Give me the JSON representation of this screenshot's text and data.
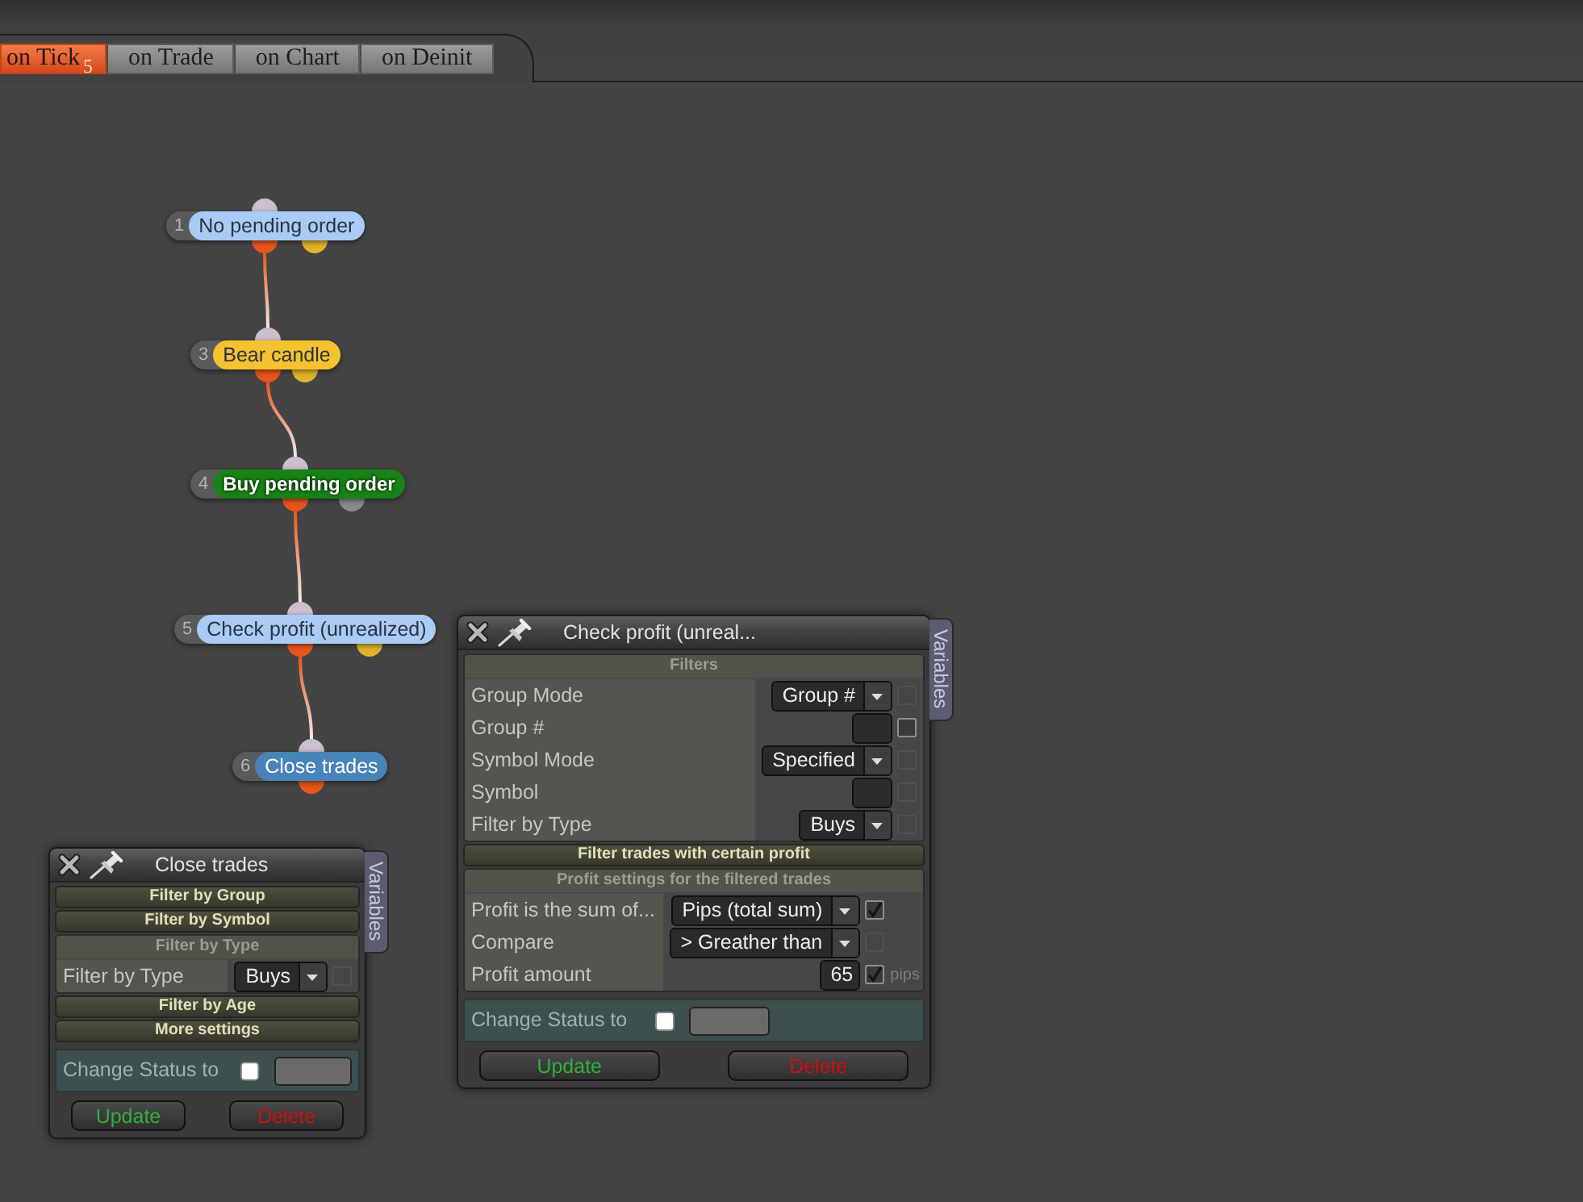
{
  "tabs": [
    {
      "label": "on Tick",
      "count": "5",
      "selected": true
    },
    {
      "label": "on Trade",
      "selected": false
    },
    {
      "label": "on Chart",
      "selected": false
    },
    {
      "label": "on Deinit",
      "selected": false
    }
  ],
  "nodes": [
    {
      "number": "1",
      "label": "No pending order",
      "color": "#a9cbf5",
      "emphasized": false,
      "outputs": [
        {
          "color": "#e8561c",
          "linked": true
        },
        {
          "color": "#e2b42c",
          "linked": false
        }
      ]
    },
    {
      "number": "3",
      "label": "Bear candle",
      "color": "#f5c12e",
      "emphasized": false,
      "outputs": [
        {
          "color": "#e8561c",
          "linked": true
        },
        {
          "color": "#e2b42c",
          "linked": false
        }
      ]
    },
    {
      "number": "4",
      "label": "Buy pending order",
      "color": "#178317",
      "emphasized": true,
      "outputs": [
        {
          "color": "#e8561c",
          "linked": true
        },
        {
          "color": "#8a8a8a",
          "linked": false
        }
      ]
    },
    {
      "number": "5",
      "label": "Check profit (unrealized)",
      "color": "#a9cbf5",
      "emphasized": false,
      "outputs": [
        {
          "color": "#e8561c",
          "linked": true
        },
        {
          "color": "#e2b42c",
          "linked": false
        }
      ]
    },
    {
      "number": "6",
      "label": "Close trades",
      "color": "#4884b8",
      "emphasized": false,
      "outputs": [
        {
          "color": "#e8561c",
          "linked": false
        }
      ]
    }
  ],
  "panels": [
    {
      "title": "Check profit (unreal...",
      "side_tab": "Variables",
      "sections": [
        {
          "label": "Filters",
          "expanded": true,
          "rows": [
            {
              "label": "Group Mode",
              "control": {
                "kind": "select",
                "value": "Group #"
              },
              "checkbox": {
                "checked": false,
                "disabled": true
              }
            },
            {
              "label": "Group #",
              "control": {
                "kind": "input"
              },
              "checkbox": {
                "checked": false,
                "disabled": false
              }
            },
            {
              "label": "Symbol Mode",
              "control": {
                "kind": "select",
                "value": "Specified"
              },
              "checkbox": {
                "checked": false,
                "disabled": true
              }
            },
            {
              "label": "Symbol",
              "control": {
                "kind": "input"
              },
              "checkbox": {
                "checked": false,
                "disabled": true
              }
            },
            {
              "label": "Filter by Type",
              "control": {
                "kind": "select",
                "value": "Buys"
              },
              "checkbox": {
                "checked": false,
                "disabled": true
              }
            }
          ]
        },
        {
          "label": "Filter trades with certain profit",
          "expanded": false
        },
        {
          "label": "Profit settings for the filtered trades",
          "expanded": true,
          "rows": [
            {
              "label": "Profit is the sum of...",
              "control": {
                "kind": "select",
                "value": "Pips (total sum)"
              },
              "checkbox": {
                "checked": true,
                "disabled": false
              }
            },
            {
              "label": "Compare",
              "control": {
                "kind": "select",
                "value": "> Greather than"
              },
              "checkbox": {
                "checked": false,
                "disabled": true
              }
            },
            {
              "label": "Profit amount",
              "control": {
                "kind": "input",
                "value": "65"
              },
              "checkbox": {
                "checked": true,
                "disabled": false
              },
              "unit": "pips"
            }
          ]
        }
      ],
      "status": {
        "label": "Change Status to",
        "checked": false
      },
      "buttons": [
        {
          "label": "Update",
          "kind": "update"
        },
        {
          "label": "Delete",
          "kind": "delete"
        }
      ]
    },
    {
      "title": "Close trades",
      "side_tab": "Variables",
      "sections": [
        {
          "label": "Filter by Group",
          "expanded": false
        },
        {
          "label": "Filter by Symbol",
          "expanded": false
        },
        {
          "label": "Filter by Type",
          "expanded": true,
          "rows": [
            {
              "label": "Filter by Type",
              "control": {
                "kind": "select",
                "value": "Buys"
              },
              "checkbox": {
                "checked": false,
                "disabled": true
              }
            }
          ]
        },
        {
          "label": "Filter by Age",
          "expanded": false
        },
        {
          "label": "More settings",
          "expanded": false
        }
      ],
      "status": {
        "label": "Change Status to",
        "checked": false
      },
      "buttons": [
        {
          "label": "Update",
          "kind": "update"
        },
        {
          "label": "Delete",
          "kind": "delete"
        }
      ]
    }
  ]
}
